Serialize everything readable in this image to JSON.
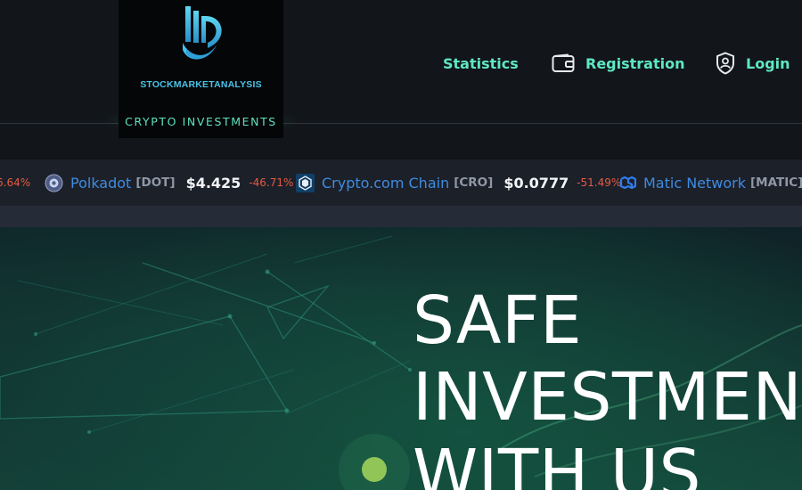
{
  "brand": {
    "name": "STOCKMARKETANALYSIS",
    "tagline": "CRYPTO INVESTMENTS",
    "logo_icon": "stylized-letters-logo"
  },
  "nav": {
    "statistics": "Statistics",
    "registration": "Registration",
    "login": "Login",
    "registration_icon": "wallet-icon",
    "login_icon": "shield-user-icon"
  },
  "ticker": {
    "leading_change": "6.64%",
    "items": [
      {
        "name": "Polkadot",
        "symbol": "[DOT]",
        "price": "$4.425",
        "change": "-46.71%",
        "icon": "polkadot-icon"
      },
      {
        "name": "Crypto.com Chain",
        "symbol": "[CRO]",
        "price": "$0.0777",
        "change": "-51.49%",
        "icon": "cro-icon"
      },
      {
        "name": "Matic Network",
        "symbol": "[MATIC]",
        "price": "",
        "change": "",
        "icon": "matic-icon"
      }
    ]
  },
  "hero": {
    "line1": "SAFE",
    "line2": "INVESTMENT",
    "line3": "WITH US"
  },
  "colors": {
    "accent": "#5ee8c4",
    "coin_name": "#3e8ce0",
    "negative": "#e55a42",
    "logo_text": "#49c4e8"
  }
}
